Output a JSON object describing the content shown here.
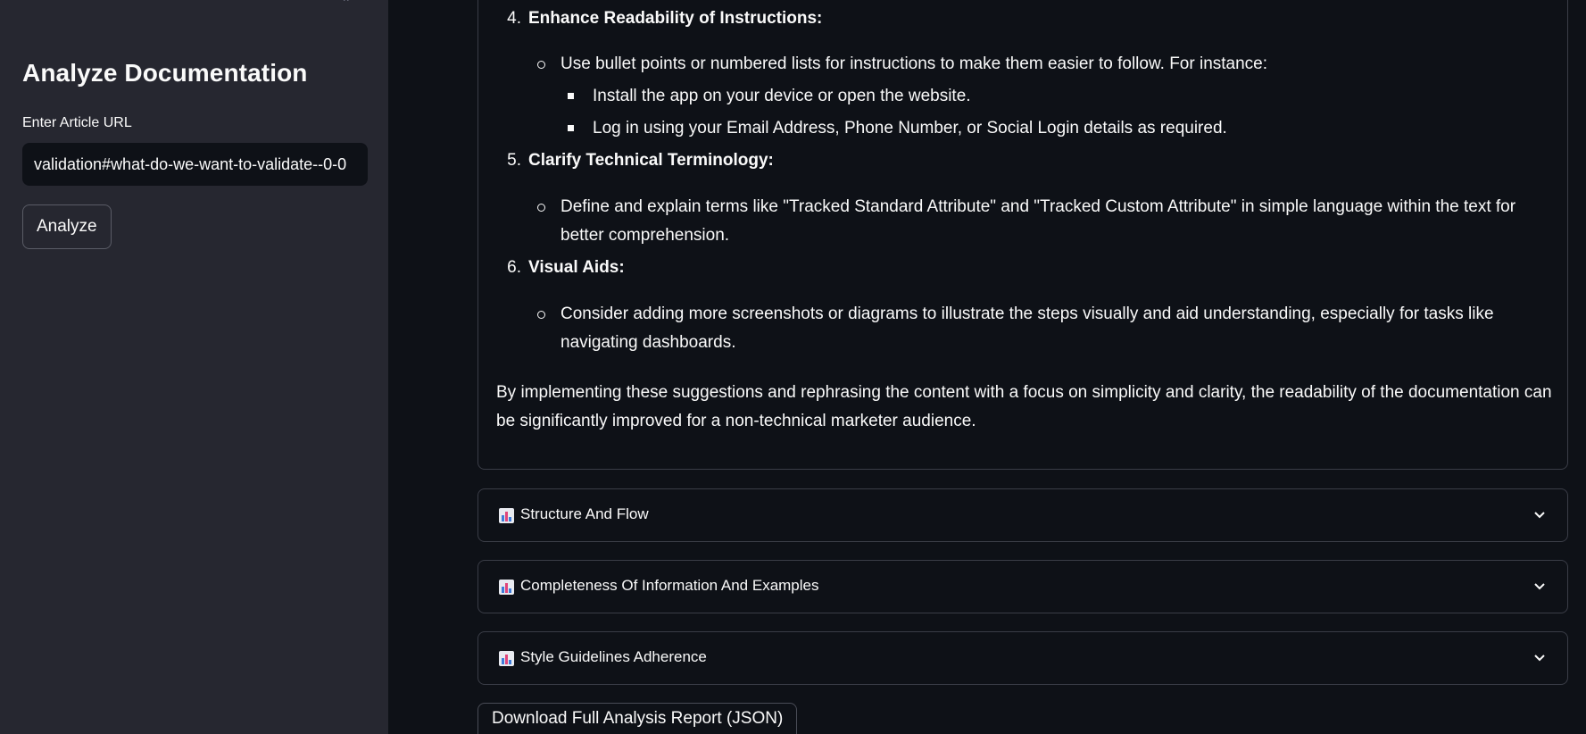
{
  "sidebar": {
    "top_hint": "^",
    "heading": "Analyze Documentation",
    "url_label": "Enter Article URL",
    "url_value": "validation#what-do-we-want-to-validate--0-0",
    "analyze_label": "Analyze"
  },
  "report": {
    "items": [
      {
        "number": "4.",
        "title": "Enhance Readability of Instructions:",
        "bullets": [
          {
            "text": "Use bullet points or numbered lists for instructions to make them easier to follow. For instance:",
            "subitems": [
              "Install the app on your device or open the website.",
              "Log in using your Email Address, Phone Number, or Social Login details as required."
            ]
          }
        ]
      },
      {
        "number": "5.",
        "title": "Clarify Technical Terminology:",
        "bullets": [
          {
            "line1": "Define and explain terms like \"Tracked Standard Attribute\" and \"Tracked Custom Attribute\" in simple language within the text for",
            "line2": "better comprehension."
          }
        ]
      },
      {
        "number": "6.",
        "title": "Visual Aids:",
        "bullets": [
          {
            "line1": "Consider adding more screenshots or diagrams to illustrate the steps visually and aid understanding, especially for tasks like",
            "line2": "navigating dashboards."
          }
        ]
      }
    ],
    "closing_line1": "By implementing these suggestions and rephrasing the content with a focus on simplicity and clarity, the readability of the documentation can",
    "closing_line2": "be significantly improved for a non-technical marketer audience."
  },
  "expanders": [
    {
      "label": "Structure And Flow",
      "icon": "bar-chart-icon"
    },
    {
      "label": "Completeness Of Information And Examples",
      "icon": "bar-chart-icon"
    },
    {
      "label": "Style Guidelines Adherence",
      "icon": "bar-chart-icon"
    }
  ],
  "download_label": "Download Full Analysis Report (JSON)",
  "colors": {
    "sidebar_bg": "#262730",
    "main_bg": "#0e1117",
    "text": "#fafafa",
    "border": "#3a3d47"
  }
}
